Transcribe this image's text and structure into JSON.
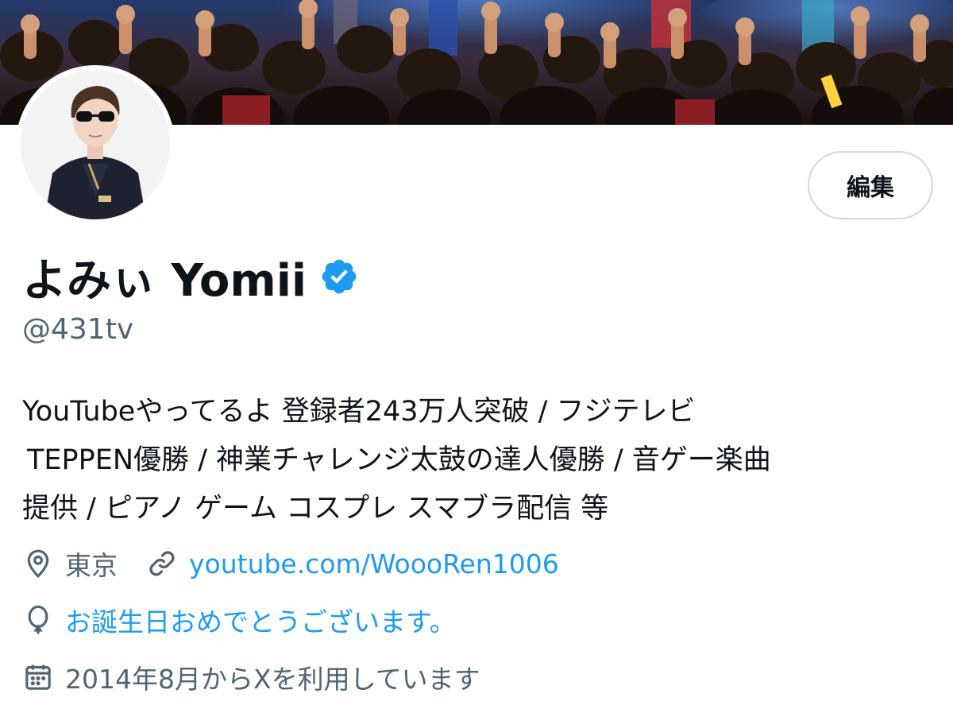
{
  "profile": {
    "display_name": "よみぃ Yomii",
    "handle": "@431tv",
    "verified": true,
    "edit_label": "編集",
    "bio_lines": [
      "YouTubeやってるよ 登録者243万人突破 / フジテレビ",
      "TEPPEN優勝 / 神業チャレンジ太鼓の達人優勝 / 音ゲー楽曲",
      "提供 / ピアノ ゲーム コスプレ スマブラ配信 等"
    ],
    "location": "東京",
    "website": "youtube.com/WoooRen1006",
    "birthday_text": "お誕生日おめでとうございます。",
    "joined_text": "2014年8月からXを利用しています"
  },
  "colors": {
    "accent": "#1d9bf0",
    "secondary_text": "#536471",
    "primary_text": "#0f1419",
    "border": "#cfd9de"
  },
  "icons": {
    "verified": "verified-badge-icon",
    "location": "map-pin-icon",
    "website": "link-icon",
    "birthday": "balloon-icon",
    "joined": "calendar-icon"
  }
}
